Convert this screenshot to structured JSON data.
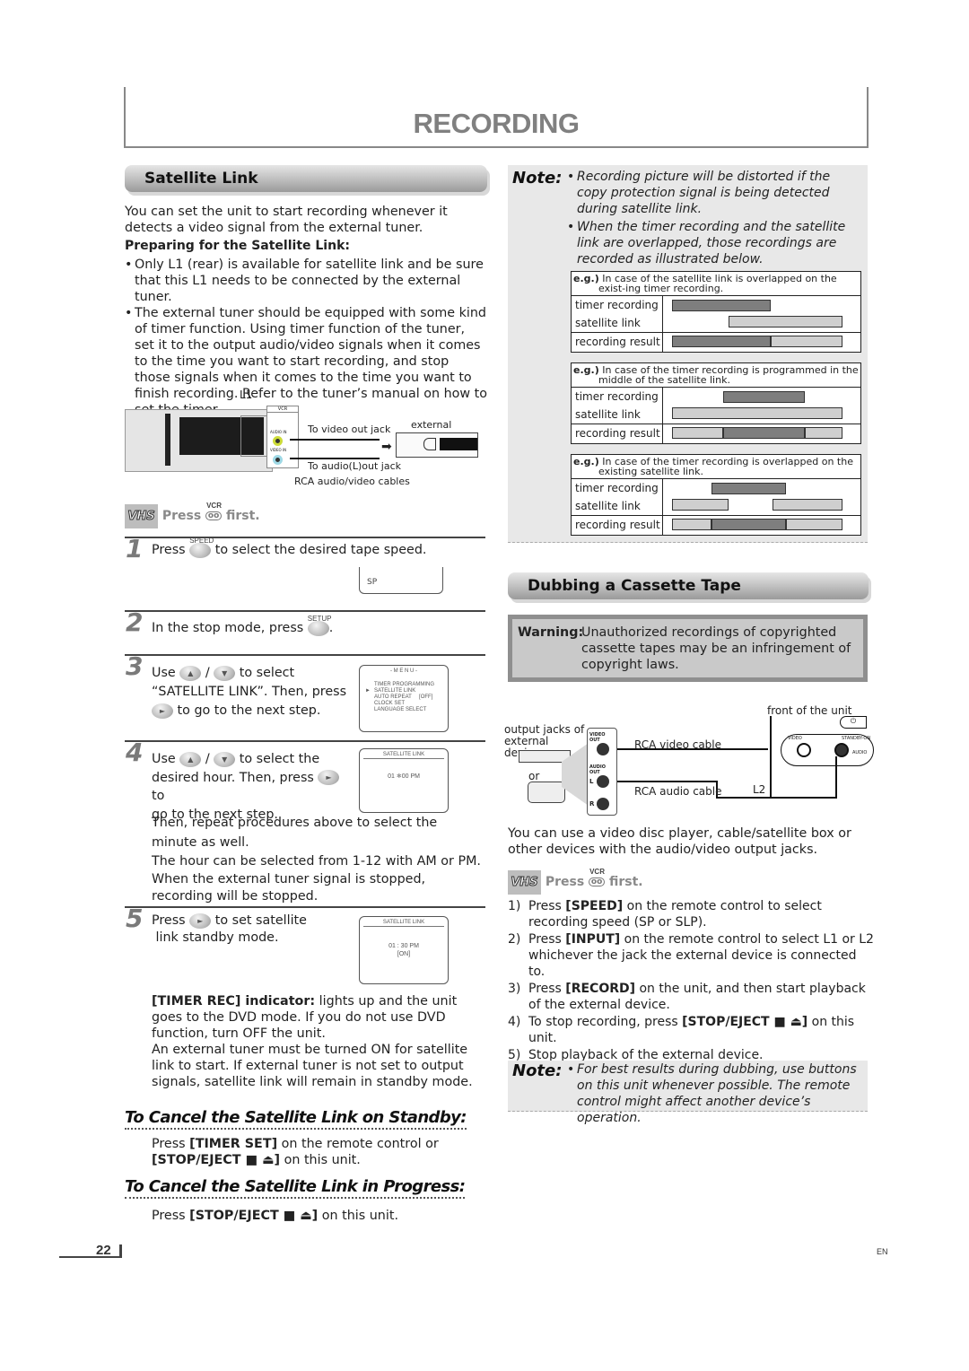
{
  "page": {
    "title": "RECORDING",
    "page_number": "22",
    "language": "EN"
  },
  "satellite": {
    "heading": "Satellite Link",
    "intro": "You can set the unit to start recording whenever it detects a video signal from the external tuner.",
    "prep_heading": "Preparing for the Satellite Link:",
    "bullets": [
      "Only L1 (rear) is available for satellite link and be sure that this L1 needs to be connected by the external tuner.",
      "The external tuner should be equipped with some kind of timer function. Using timer function of the tuner, set it to the output audio/video signals when it comes to the time you want to start recording, and stop those signals when it comes to the time you want to finish recording. Refer to the tuner’s manual on how to set the timer."
    ],
    "diagram": {
      "l1_label": "L1",
      "vcr_label": "VCR",
      "audio_in": "AUDIO IN",
      "video_in": "VIDEO IN",
      "video_jack": "To video out jack",
      "audio_jack": "To audio(L)out jack",
      "cables": "RCA audio/video cables",
      "tuner": "external tuner"
    },
    "vhs": {
      "logo": "VHS",
      "press": "Press",
      "vcr": "VCR",
      "first": "first."
    },
    "steps": [
      {
        "num": "1",
        "pre": "Press",
        "button": "SPEED",
        "post": "to select the desired tape speed.",
        "osd": "SP"
      },
      {
        "num": "2",
        "pre": "In the stop mode, press",
        "button": "SETUP",
        "post": "."
      },
      {
        "num": "3",
        "pre": "Use",
        "sep": "/",
        "post1": "to select",
        "line2": "“SATELLITE LINK”. Then, press",
        "line3": "to go to the next step.",
        "osd": {
          "title": "- M E N U -",
          "items": [
            "TIMER PROGRAMMING",
            "SATELLITE LINK",
            "AUTO REPEAT",
            "CLOCK SET",
            "LANGUAGE SELECT"
          ],
          "auto_repeat_value": "[OFF]",
          "selected": "SATELLITE LINK"
        }
      },
      {
        "num": "4",
        "pre": "Use",
        "sep": "/",
        "post1": "to select the",
        "line2": "desired hour. Then, press",
        "line2b": "to",
        "line3": "go to the next step.",
        "extra": [
          "Then, repeat procedures above to select the minute as well.",
          "The hour can be selected from 1-12 with AM or PM.",
          "When the external tuner signal is stopped, recording will be stopped."
        ],
        "osd": {
          "title": "SATELLITE LINK",
          "hour": "01",
          "minute": "00",
          "ampm": "PM"
        }
      },
      {
        "num": "5",
        "pre": "Press",
        "post": "to set satellite",
        "line2": "link standby mode.",
        "osd": {
          "title": "SATELLITE LINK",
          "time": "01 : 30  PM",
          "status": "[ON]"
        }
      }
    ],
    "timer_rec_label": "[TIMER REC] indicator:",
    "timer_rec_text": " lights up and the unit goes to the DVD mode. If you do not use DVD function, turn OFF the unit.",
    "external_tuner_text": "An external tuner must be turned ON for satellite link to start. If external tuner is not set to output signals, satellite link will remain in standby mode.",
    "cancel_standby": {
      "heading": "To Cancel the Satellite Link on Standby:",
      "pre": "Press ",
      "bold1": "[TIMER SET]",
      "mid": " on the remote control or",
      "bold2": "[STOP/EJECT ■ ⏏]",
      "post": " on this unit."
    },
    "cancel_progress": {
      "heading": "To Cancel the Satellite Link in Progress:",
      "pre": "Press ",
      "bold": "[STOP/EJECT ■ ⏏]",
      "post": " on this unit."
    }
  },
  "note1": {
    "label": "Note:",
    "bullets": [
      "Recording picture will be distorted if the copy protection signal is being detected during satellite link.",
      "When the timer recording and the satellite link are overlapped, those recordings are recorded as illustrated below."
    ],
    "examples": [
      {
        "eg": "e.g.)",
        "caption": "In case of the satellite link is overlapped on the exist-ing timer recording.",
        "rows": [
          "timer recording",
          "satellite link",
          "recording result"
        ],
        "timer": [
          [
            0.0,
            0.58
          ]
        ],
        "satellite": [
          [
            0.33,
            1.0
          ]
        ],
        "result": [
          {
            "from": 0.0,
            "to": 0.58,
            "kind": "timer"
          },
          {
            "from": 0.58,
            "to": 1.0,
            "kind": "satellite"
          }
        ]
      },
      {
        "eg": "e.g.)",
        "caption": "In case of the timer recording is programmed in the middle of the satellite link.",
        "rows": [
          "timer recording",
          "satellite link",
          "recording result"
        ],
        "timer": [
          [
            0.3,
            0.78
          ]
        ],
        "satellite": [
          [
            0.0,
            1.0
          ]
        ],
        "result": [
          {
            "from": 0.0,
            "to": 0.3,
            "kind": "satellite"
          },
          {
            "from": 0.3,
            "to": 0.78,
            "kind": "timer"
          },
          {
            "from": 0.78,
            "to": 1.0,
            "kind": "satellite"
          }
        ]
      },
      {
        "eg": "e.g.)",
        "caption": "In case of the timer recording is overlapped on the existing satellite link.",
        "rows": [
          "timer recording",
          "satellite link",
          "recording result"
        ],
        "timer": [
          [
            0.23,
            0.67
          ]
        ],
        "satellite": [
          [
            0.0,
            0.33
          ],
          [
            0.59,
            1.0
          ]
        ],
        "result": [
          {
            "from": 0.0,
            "to": 0.23,
            "kind": "satellite"
          },
          {
            "from": 0.23,
            "to": 0.67,
            "kind": "timer"
          },
          {
            "from": 0.67,
            "to": 1.0,
            "kind": "satellite"
          }
        ]
      }
    ]
  },
  "dubbing": {
    "heading": "Dubbing a Cassette Tape",
    "warning_label": "Warning:",
    "warning_text": "Unauthorized recordings of copyrighted cassette tapes may be an infringement of copyright laws.",
    "diagram": {
      "front": "front of the unit",
      "output_jacks": "output jacks of external device",
      "or": "or",
      "video_out": "VIDEO OUT",
      "audio_out": "AUDIO OUT",
      "l": "L",
      "r": "R",
      "video_cable": "RCA video cable",
      "audio_cable": "RCA audio cable",
      "l2": "L2",
      "video": "VIDEO",
      "audio": "AUDIO",
      "standby": "STANDBY-ON"
    },
    "intro": "You can use a video disc player, cable/satellite box or other devices with the audio/video output jacks.",
    "vhs": {
      "logo": "VHS",
      "press": "Press",
      "vcr": "VCR",
      "first": "first."
    },
    "steps": [
      {
        "n": "1)",
        "pre": "Press ",
        "bold": "[SPEED]",
        "post": " on the remote control to select recording speed (SP or SLP)."
      },
      {
        "n": "2)",
        "pre": "Press ",
        "bold": "[INPUT]",
        "post": " on the remote control to select L1 or L2 whichever the jack the external device is connected to."
      },
      {
        "n": "3)",
        "pre": "Press ",
        "bold": "[RECORD]",
        "post": " on the unit, and then start playback of the external device."
      },
      {
        "n": "4)",
        "pre": "To stop recording, press ",
        "bold": "[STOP/EJECT ■ ⏏]",
        "post": " on this unit."
      },
      {
        "n": "5)",
        "pre": "Stop playback of the external device.",
        "bold": "",
        "post": ""
      }
    ],
    "note_label": "Note:",
    "note_text": "For best results during dubbing, use buttons on this unit whenever possible. The remote control might affect another device’s operation."
  }
}
